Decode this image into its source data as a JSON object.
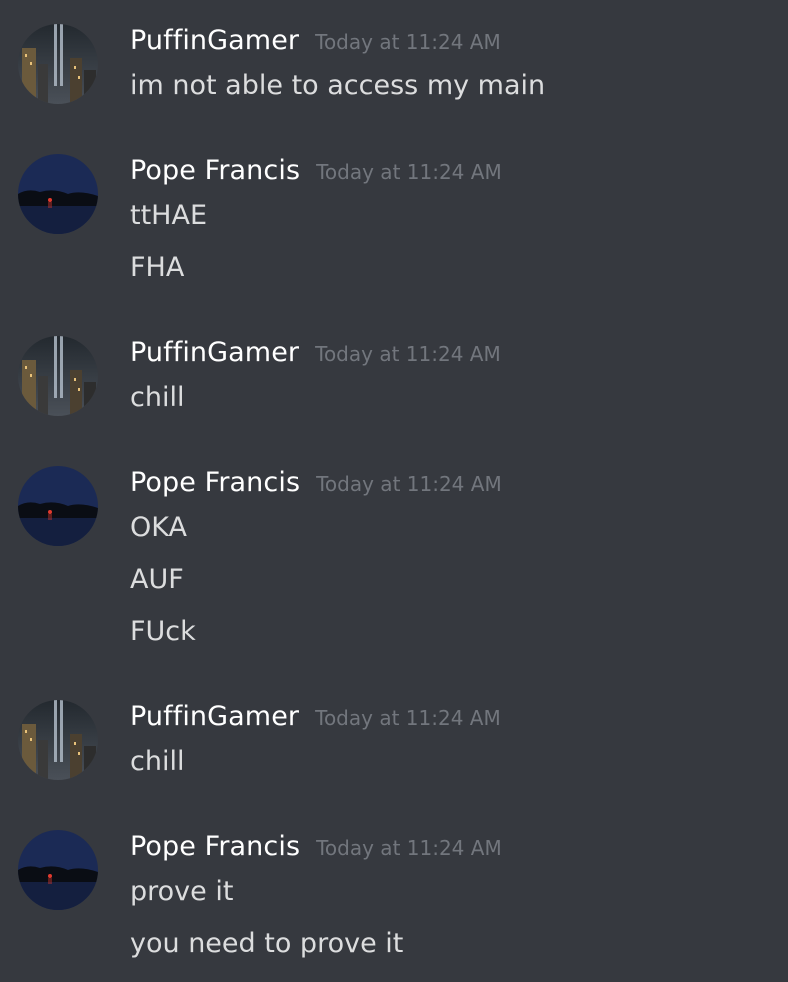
{
  "messages": [
    {
      "author": "PuffinGamer",
      "avatar": "city-lights-avatar",
      "timestamp": "Today at 11:24 AM",
      "lines": [
        "im not able to access my main"
      ]
    },
    {
      "author": "Pope Francis",
      "avatar": "night-shoreline-avatar",
      "timestamp": "Today at 11:24 AM",
      "lines": [
        "ttHAE",
        "FHA"
      ]
    },
    {
      "author": "PuffinGamer",
      "avatar": "city-lights-avatar",
      "timestamp": "Today at 11:24 AM",
      "lines": [
        "chill"
      ]
    },
    {
      "author": "Pope Francis",
      "avatar": "night-shoreline-avatar",
      "timestamp": "Today at 11:24 AM",
      "lines": [
        "OKA",
        "AUF",
        "FUck"
      ]
    },
    {
      "author": "PuffinGamer",
      "avatar": "city-lights-avatar",
      "timestamp": "Today at 11:24 AM",
      "lines": [
        "chill"
      ]
    },
    {
      "author": "Pope Francis",
      "avatar": "night-shoreline-avatar",
      "timestamp": "Today at 11:24 AM",
      "lines": [
        "prove it",
        "you need to prove it"
      ]
    }
  ],
  "colors": {
    "background": "#36393f",
    "username": "#ffffff",
    "timestamp": "#72767d",
    "message_text": "#dcddde"
  }
}
